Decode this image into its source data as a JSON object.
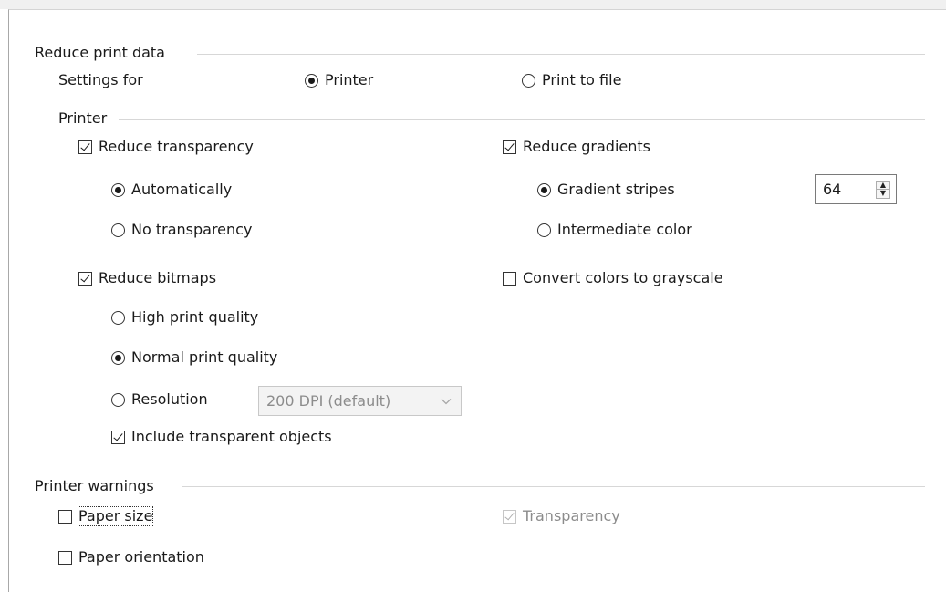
{
  "reduce_print_data": {
    "heading": "Reduce print data",
    "settings_for_label": "Settings for",
    "printer_option": "Printer",
    "print_to_file_option": "Print to file"
  },
  "printer_section": {
    "heading": "Printer",
    "reduce_transparency": "Reduce transparency",
    "automatically": "Automatically",
    "no_transparency": "No transparency",
    "reduce_gradients": "Reduce gradients",
    "gradient_stripes": "Gradient stripes",
    "gradient_stripes_value": "64",
    "intermediate_color": "Intermediate color",
    "reduce_bitmaps": "Reduce bitmaps",
    "high_print_quality": "High print quality",
    "normal_print_quality": "Normal print quality",
    "resolution": "Resolution",
    "resolution_value": "200 DPI (default)",
    "include_transparent_objects": "Include transparent objects",
    "convert_to_grayscale": "Convert colors to grayscale"
  },
  "printer_warnings": {
    "heading": "Printer warnings",
    "paper_size": "Paper size",
    "transparency": "Transparency",
    "paper_orientation": "Paper orientation"
  }
}
